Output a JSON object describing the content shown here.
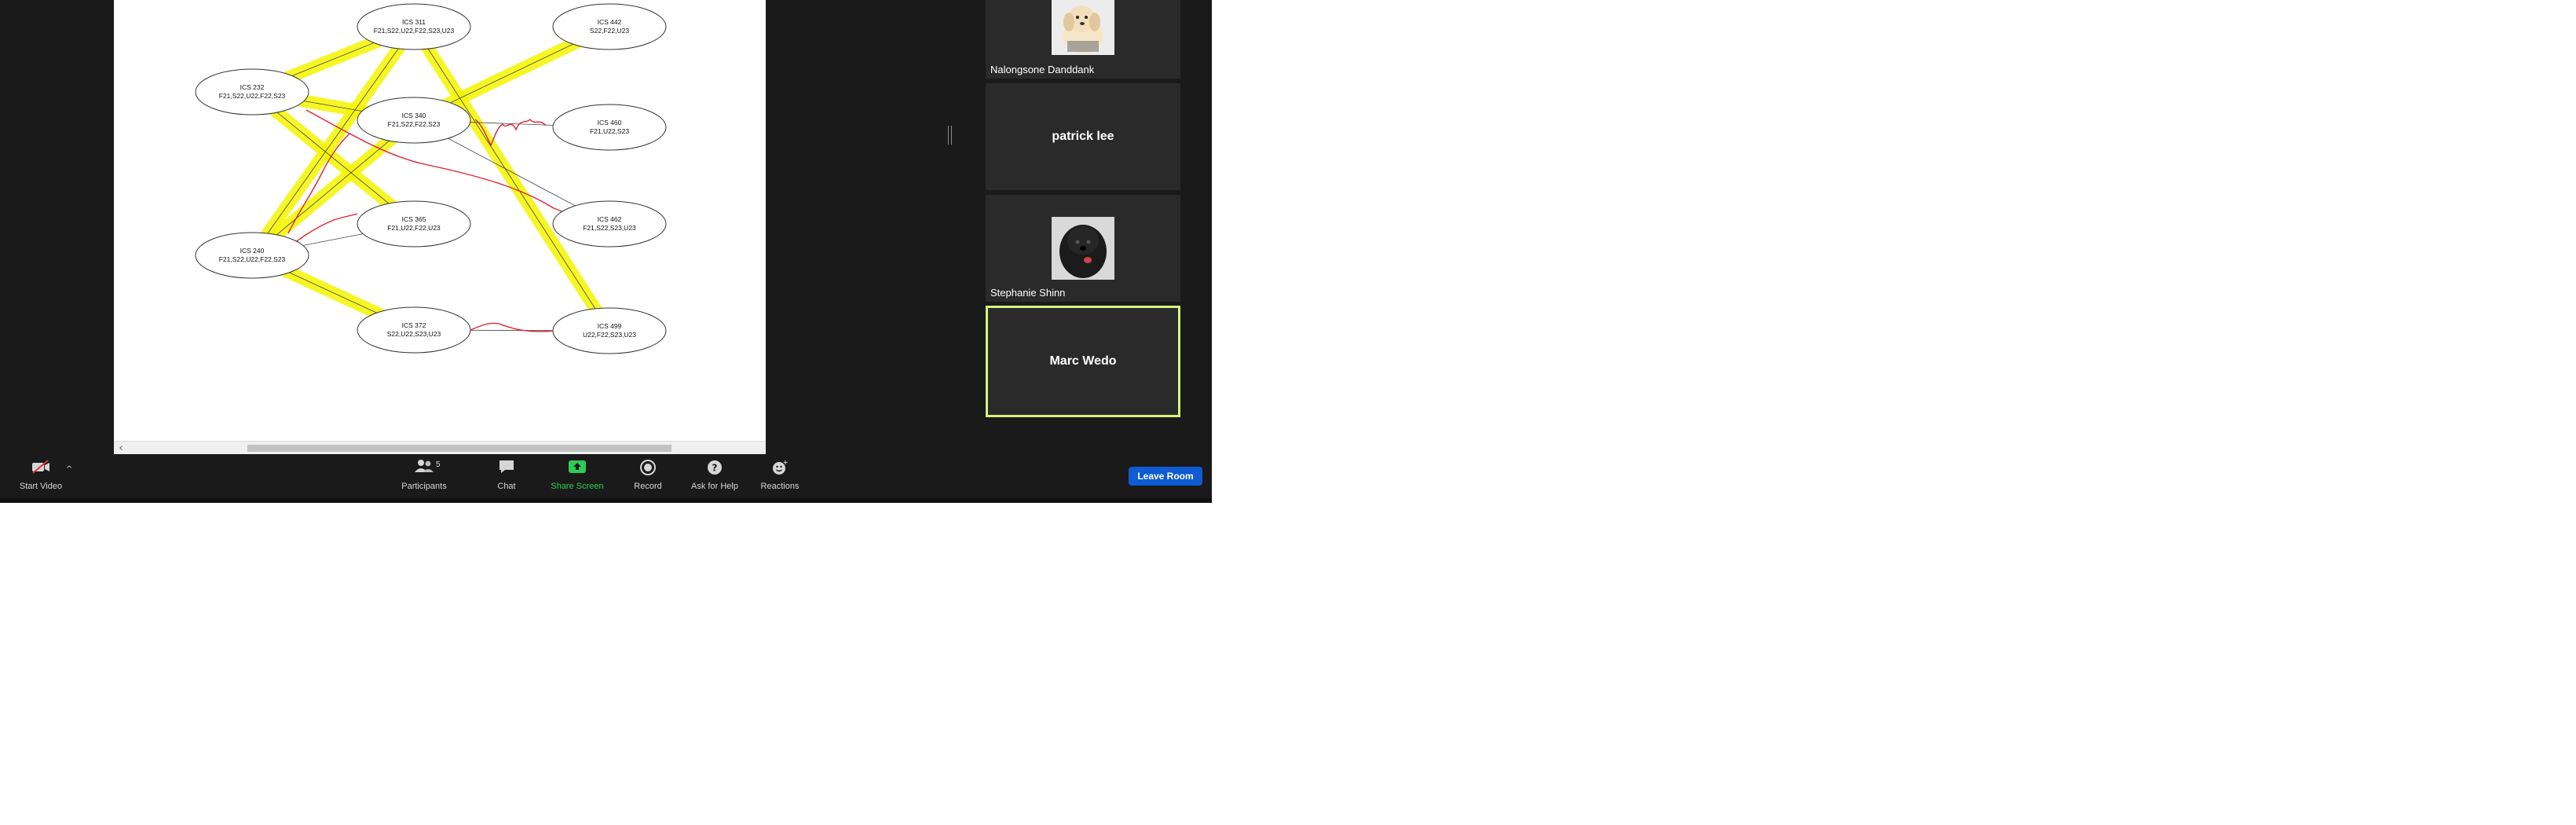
{
  "shared_screen": {
    "diagram": {
      "nodes": [
        {
          "id": "ics311",
          "title": "ICS 311",
          "terms": "F21,S22,U22,F22,S23,U23"
        },
        {
          "id": "ics442",
          "title": "ICS 442",
          "terms": "S22,F22,U23"
        },
        {
          "id": "ics232",
          "title": "ICS 232",
          "terms": "F21,S22,U22,F22,S23"
        },
        {
          "id": "ics340",
          "title": "ICS 340",
          "terms": "F21,S22,F22,S23"
        },
        {
          "id": "ics460",
          "title": "ICS 460",
          "terms": "F21,U22,S23"
        },
        {
          "id": "ics365",
          "title": "ICS 365",
          "terms": "F21,U22,F22,U23"
        },
        {
          "id": "ics462",
          "title": "ICS 462",
          "terms": "F21,S22,S23,U23"
        },
        {
          "id": "ics240",
          "title": "ICS 240",
          "terms": "F21,S22,U22,F22,S23"
        },
        {
          "id": "ics372",
          "title": "ICS 372",
          "terms": "S22,U22,S23,U23"
        },
        {
          "id": "ics499",
          "title": "ICS 499",
          "terms": "U22,F22,S23,U23"
        }
      ],
      "highlight_color": "#f5f500",
      "annotation_color": "#e0242e"
    },
    "scroll_left_glyph": "‹"
  },
  "participants": [
    {
      "name": "Nalongsone Danddank",
      "has_photo": true
    },
    {
      "name": "patrick lee",
      "has_photo": false
    },
    {
      "name": "Stephanie Shinn",
      "has_photo": true
    },
    {
      "name": "Marc Wedo",
      "has_photo": false,
      "active_speaker": true
    }
  ],
  "toolbar": {
    "start_video": "Start Video",
    "participants": "Participants",
    "participants_count": "5",
    "chat": "Chat",
    "share_screen": "Share Screen",
    "record": "Record",
    "ask_for_help": "Ask for Help",
    "reactions": "Reactions",
    "leave_room": "Leave Room"
  },
  "colors": {
    "background": "#1a1a1a",
    "tile": "#2a2a2a",
    "active_speaker_border": "#d9f27a",
    "share_green": "#2ecc55",
    "leave_blue": "#0e5bd3"
  }
}
